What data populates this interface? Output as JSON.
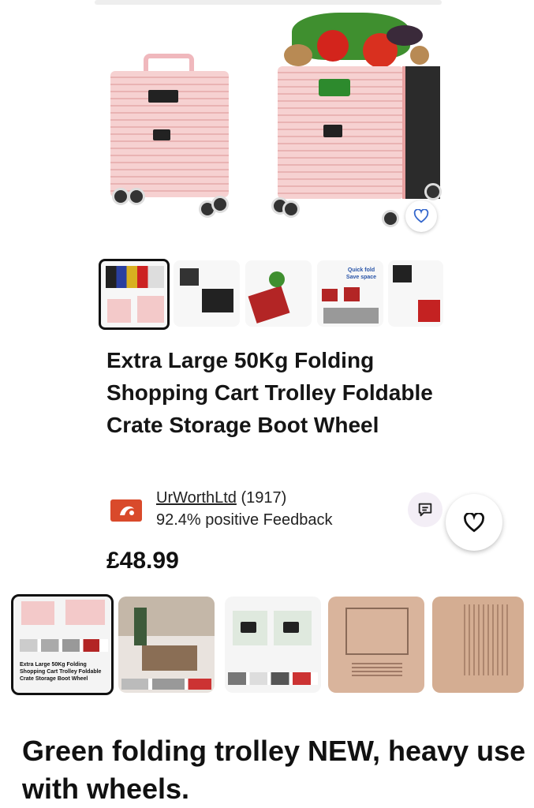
{
  "product": {
    "title": "Extra Large 50Kg Folding Shopping Cart Trolley Foldable Crate Storage Boot Wheel",
    "price": "£48.99"
  },
  "seller": {
    "name": "UrWorthLtd",
    "count": "(1917)",
    "feedback": "92.4% positive Feedback"
  },
  "thumbnails": [
    {
      "label": ""
    },
    {
      "label": ""
    },
    {
      "label": ""
    },
    {
      "label": "Quick fold Save space"
    },
    {
      "label": ""
    }
  ],
  "similar": {
    "first_card_text": "Extra Large 50Kg Folding Shopping Cart Trolley Foldable Crate Storage Boot Wheel"
  },
  "listing_title": "Green folding trolley NEW, heavy use with wheels.",
  "icons": {
    "watch": "heart-icon",
    "message": "message-icon",
    "seller_logo": "seller-logo-icon"
  },
  "colors": {
    "crate_pink": "#f3c9c9",
    "text": "#111111",
    "seller_logo": "#d94a2b"
  }
}
